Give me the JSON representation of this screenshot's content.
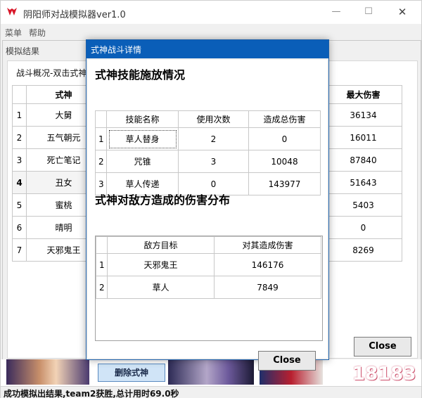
{
  "app": {
    "title": "阴阳师对战模拟器ver1.0",
    "menu": [
      "菜单",
      "帮助"
    ],
    "window_controls": {
      "minimize": "—",
      "maximize": "☐",
      "close": "✕"
    }
  },
  "results_window": {
    "title": "模拟结果",
    "overview_label": "战斗概况-双击式神",
    "shikigami_table": {
      "header": "式神",
      "rows": [
        {
          "index": "1",
          "name": "大舅"
        },
        {
          "index": "2",
          "name": "五气朝元"
        },
        {
          "index": "3",
          "name": "死亡笔记"
        },
        {
          "index": "4",
          "name": "丑女"
        },
        {
          "index": "5",
          "name": "蜜桃"
        },
        {
          "index": "6",
          "name": "晴明"
        },
        {
          "index": "7",
          "name": "天邪鬼王"
        }
      ]
    },
    "max_damage_table": {
      "header": "最大伤害",
      "values": [
        "36134",
        "16011",
        "87840",
        "51643",
        "5403",
        "0",
        "8269"
      ]
    },
    "close_label": "Close"
  },
  "bottom": {
    "delete_button": "删除式神",
    "watermark": "18183"
  },
  "status_bar": {
    "text": "成功模拟出结果,team2获胜,总计用时69.0秒"
  },
  "dialog": {
    "title": "式神战斗详情",
    "skill_heading": "式神技能施放情况",
    "skill_table": {
      "headers": [
        "技能名称",
        "使用次数",
        "造成总伤害"
      ],
      "rows": [
        {
          "index": "1",
          "name": "草人替身",
          "uses": "2",
          "damage": "0"
        },
        {
          "index": "2",
          "name": "咒锥",
          "uses": "3",
          "damage": "10048"
        },
        {
          "index": "3",
          "name": "草人传递",
          "uses": "0",
          "damage": "143977"
        }
      ]
    },
    "dist_heading": "式神对敌方造成的伤害分布",
    "dist_table": {
      "headers": [
        "敌方目标",
        "对其造成伤害"
      ],
      "rows": [
        {
          "index": "1",
          "target": "天邪鬼王",
          "damage": "146176"
        },
        {
          "index": "2",
          "target": "草人",
          "damage": "7849"
        }
      ]
    },
    "close_label": "Close"
  },
  "colors": {
    "dialog_titlebar": "#0a5eb8",
    "logo": "#d8182a",
    "delete_button_bg": "#d0e4f7"
  },
  "icons": {
    "logo": "app-logo-icon"
  }
}
